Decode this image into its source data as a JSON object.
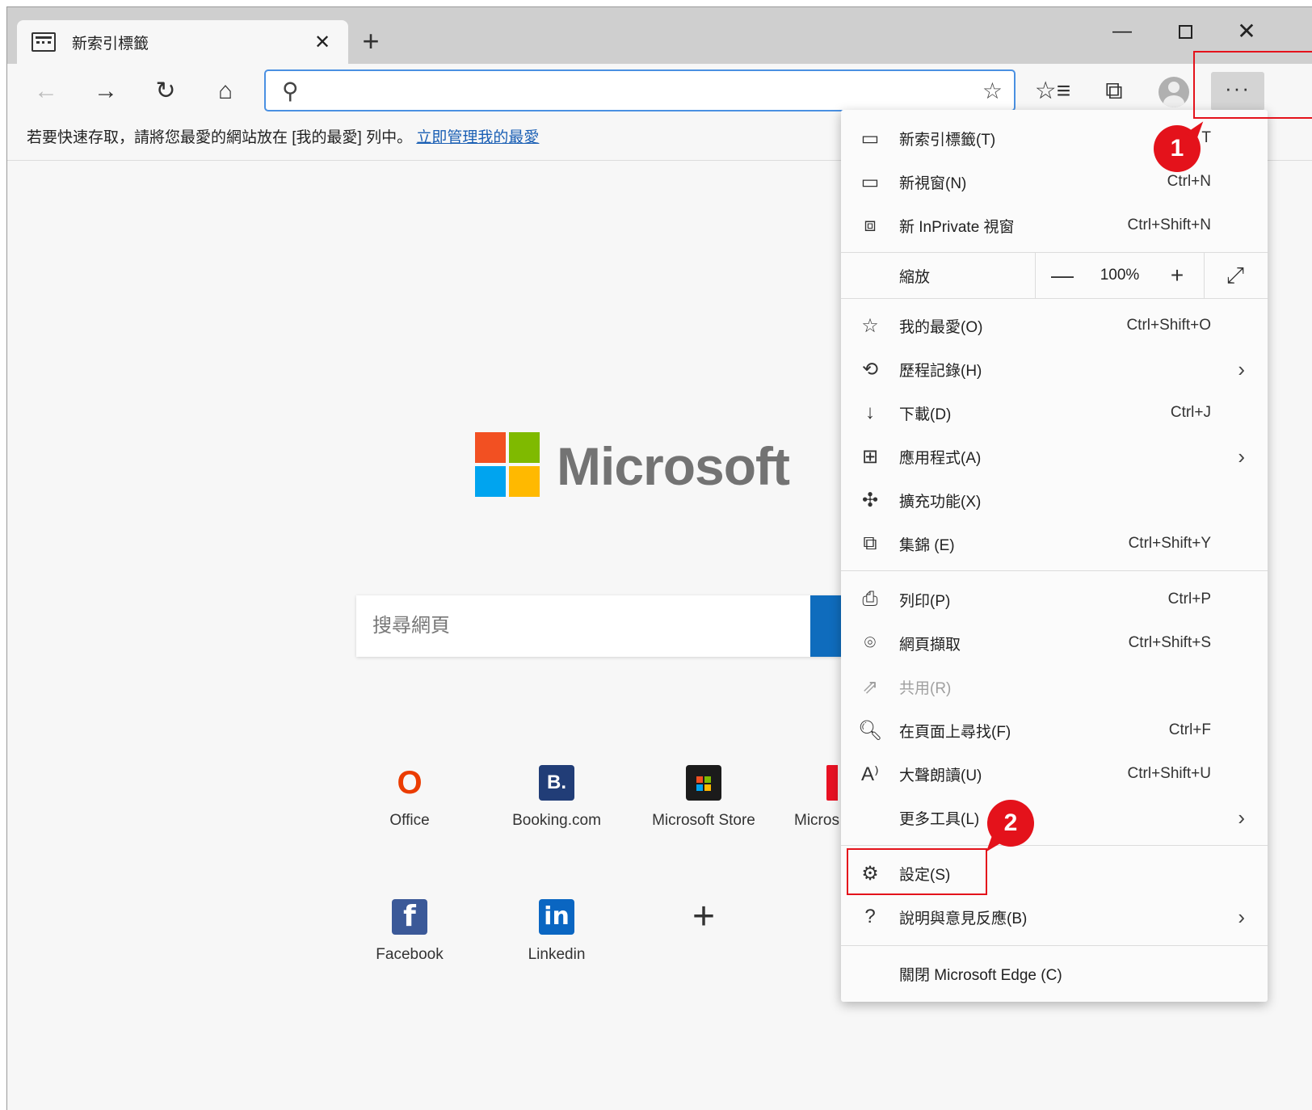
{
  "tab": {
    "title": "新索引標籤",
    "close": "✕"
  },
  "new_tab_label": "+",
  "window": {
    "minimize": "—",
    "close": "✕"
  },
  "toolbar": {
    "back": "←",
    "forward": "→",
    "reload": "↻",
    "home": "⌂",
    "search_glyph": "⚲",
    "favorite_star": "☆",
    "favorites": "☆≡",
    "collections": "⧉",
    "more": "···"
  },
  "favbar": {
    "text": "若要快速存取，請將您最愛的網站放在 [我的最愛] 列中。",
    "link": "立即管理我的最愛"
  },
  "page": {
    "brand": "Microsoft",
    "search_placeholder": "搜尋網頁",
    "tiles": [
      {
        "label": "Office",
        "glyph": "O"
      },
      {
        "label": "Booking.com",
        "glyph": "B."
      },
      {
        "label": "Microsoft Store",
        "glyph": ""
      },
      {
        "label": "Micros"
      },
      {
        "label": "Facebook",
        "glyph": "f"
      },
      {
        "label": "Linkedin",
        "glyph": "in"
      },
      {
        "label": "",
        "glyph": "+"
      }
    ]
  },
  "menu": {
    "new_tab": {
      "label": "新索引標籤(T)",
      "shortcut": "T"
    },
    "new_window": {
      "label": "新視窗(N)",
      "shortcut": "Ctrl+N"
    },
    "new_inprivate": {
      "label": "新 InPrivate 視窗",
      "shortcut": "Ctrl+Shift+N"
    },
    "zoom": {
      "label": "縮放",
      "minus": "—",
      "value": "100%",
      "plus": "+",
      "fullscreen": "⤢"
    },
    "favorites": {
      "label": "我的最愛(O)",
      "shortcut": "Ctrl+Shift+O"
    },
    "history": {
      "label": "歷程記錄(H)"
    },
    "downloads": {
      "label": "下載(D)",
      "shortcut": "Ctrl+J"
    },
    "apps": {
      "label": "應用程式(A)"
    },
    "extensions": {
      "label": "擴充功能(X)"
    },
    "collections": {
      "label": "集錦 (E)",
      "shortcut": "Ctrl+Shift+Y"
    },
    "print": {
      "label": "列印(P)",
      "shortcut": "Ctrl+P"
    },
    "web_capture": {
      "label": "網頁擷取",
      "shortcut": "Ctrl+Shift+S"
    },
    "share": {
      "label": "共用(R)"
    },
    "find": {
      "label": "在頁面上尋找(F)",
      "shortcut": "Ctrl+F"
    },
    "read_aloud": {
      "label": "大聲朗讀(U)",
      "shortcut": "Ctrl+Shift+U"
    },
    "more_tools": {
      "label": "更多工具(L)"
    },
    "settings": {
      "label": "設定(S)"
    },
    "help": {
      "label": "說明與意見反應(B)"
    },
    "close_edge": {
      "label": "關閉 Microsoft Edge (C)"
    },
    "arrow": "›"
  },
  "callouts": {
    "step1": "1",
    "step2": "2"
  },
  "colors": {
    "highlight": "#e4121b",
    "accent": "#0f6cbd",
    "link": "#1a5fb4"
  }
}
